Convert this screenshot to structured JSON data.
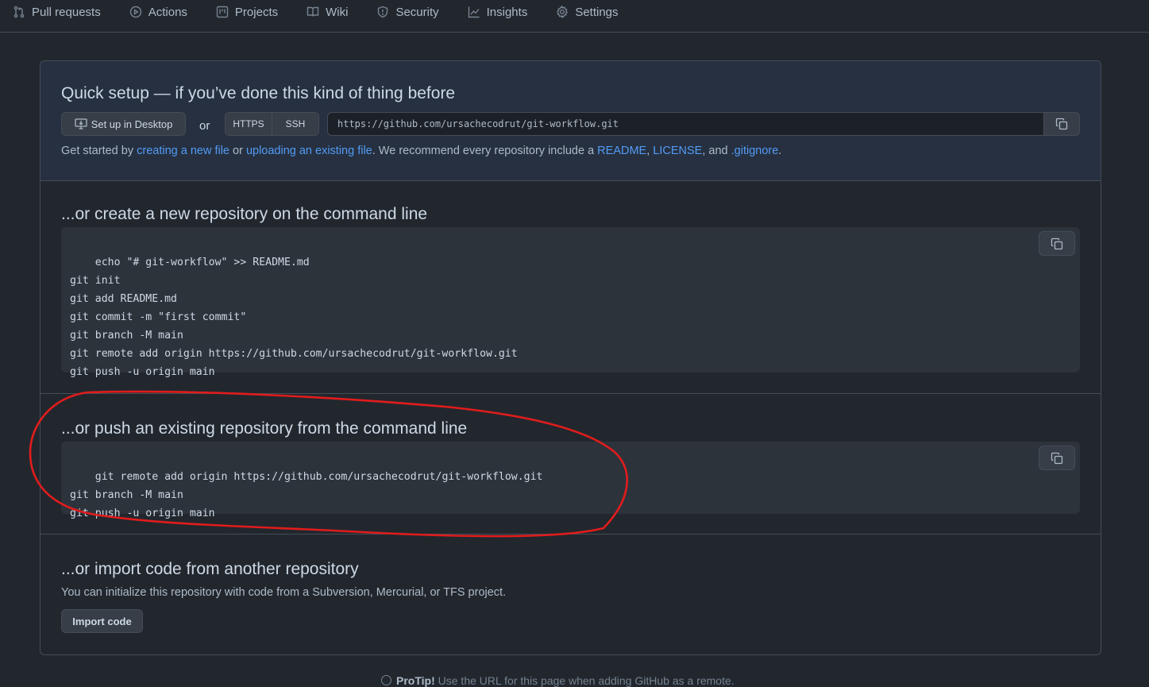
{
  "nav": {
    "items": [
      {
        "label": "Pull requests",
        "icon": "pull-request-icon"
      },
      {
        "label": "Actions",
        "icon": "play-icon"
      },
      {
        "label": "Projects",
        "icon": "project-icon"
      },
      {
        "label": "Wiki",
        "icon": "book-icon"
      },
      {
        "label": "Security",
        "icon": "shield-icon"
      },
      {
        "label": "Insights",
        "icon": "graph-icon"
      },
      {
        "label": "Settings",
        "icon": "gear-icon"
      }
    ]
  },
  "quick_setup": {
    "title": "Quick setup — if you’ve done this kind of thing before",
    "desktop_button": "Set up in Desktop",
    "or": "or",
    "protocols": [
      "HTTPS",
      "SSH"
    ],
    "url": "https://github.com/ursachecodrut/git-workflow.git",
    "get_started": {
      "prefix": "Get started by ",
      "link1": "creating a new file",
      "mid1": " or ",
      "link2": "uploading an existing file",
      "mid2": ". We recommend every repository include a ",
      "link3": "README",
      "sep1": ", ",
      "link4": "LICENSE",
      "sep2": ", and ",
      "link5": ".gitignore",
      "suffix": "."
    }
  },
  "new_repo": {
    "title": "...or create a new repository on the command line",
    "code": "echo \"# git-workflow\" >> README.md\ngit init\ngit add README.md\ngit commit -m \"first commit\"\ngit branch -M main\ngit remote add origin https://github.com/ursachecodrut/git-workflow.git\ngit push -u origin main"
  },
  "push_existing": {
    "title": "...or push an existing repository from the command line",
    "code": "git remote add origin https://github.com/ursachecodrut/git-workflow.git\ngit branch -M main\ngit push -u origin main"
  },
  "import": {
    "title": "...or import code from another repository",
    "description": "You can initialize this repository with code from a Subversion, Mercurial, or TFS project.",
    "button": "Import code"
  },
  "protip": {
    "label": "ProTip!",
    "text": " Use the URL for this page when adding GitHub as a remote."
  },
  "colors": {
    "background": "#22272e",
    "quick_setup_bg": "#263040",
    "link": "#539bf5",
    "annotation": "#e11c1c"
  }
}
